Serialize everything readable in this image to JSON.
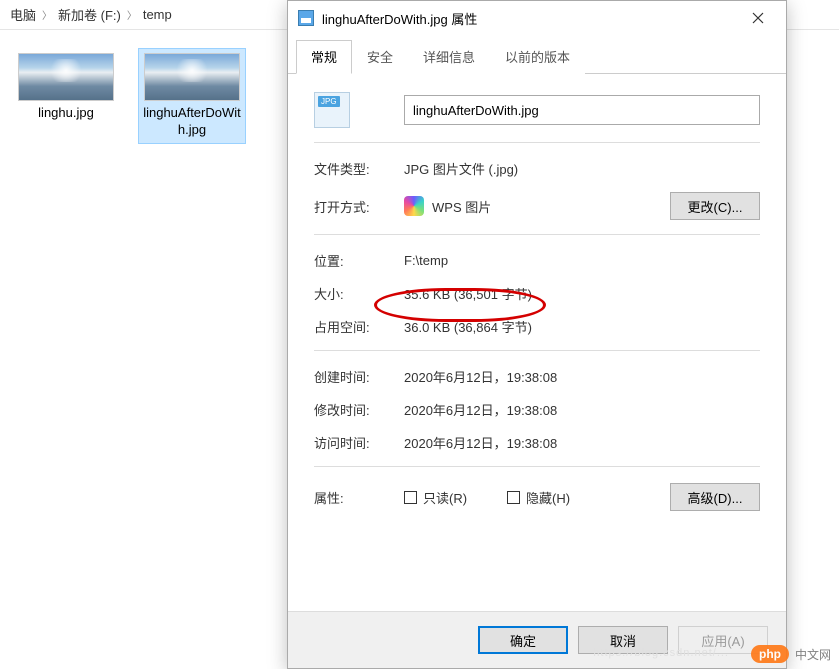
{
  "breadcrumb": {
    "part1": "电脑",
    "part2": "新加卷 (F:)",
    "part3": "temp"
  },
  "files": {
    "item0": {
      "label": "linghu.jpg"
    },
    "item1": {
      "label": "linghuAfterDoWith.jpg"
    }
  },
  "dialog": {
    "title": "linghuAfterDoWith.jpg 属性",
    "tabs": {
      "general": "常规",
      "security": "安全",
      "details": "详细信息",
      "previous": "以前的版本"
    },
    "iconBadge": "JPG",
    "filename": "linghuAfterDoWith.jpg",
    "labels": {
      "filetype": "文件类型:",
      "opens": "打开方式:",
      "location": "位置:",
      "size": "大小:",
      "diskSize": "占用空间:",
      "created": "创建时间:",
      "modified": "修改时间:",
      "accessed": "访问时间:",
      "attributes": "属性:"
    },
    "values": {
      "filetype": "JPG 图片文件 (.jpg)",
      "opensApp": "WPS 图片",
      "location": "F:\\temp",
      "size": "35.6 KB (36,501 字节)",
      "diskSize": "36.0 KB (36,864 字节)",
      "created": "2020年6月12日，19:38:08",
      "modified": "2020年6月12日，19:38:08",
      "accessed": "2020年6月12日，19:38:08"
    },
    "checkboxes": {
      "readonly": "只读(R)",
      "hidden": "隐藏(H)"
    },
    "buttons": {
      "change": "更改(C)...",
      "advanced": "高级(D)...",
      "ok": "确定",
      "cancel": "取消",
      "apply": "应用(A)"
    }
  },
  "watermark": {
    "brand": "php",
    "text": "中文网"
  }
}
